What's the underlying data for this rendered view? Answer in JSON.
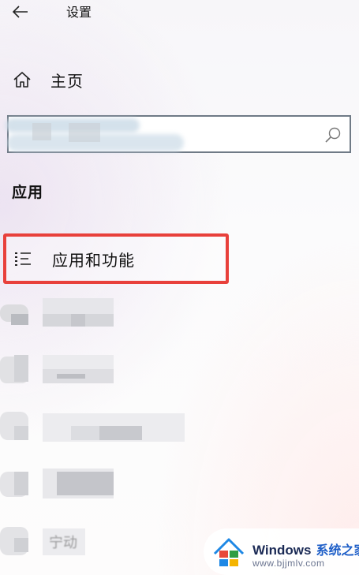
{
  "header": {
    "title": "设置",
    "back_icon": "back-arrow-icon"
  },
  "nav": {
    "home_label": "主页",
    "home_icon": "home-icon"
  },
  "search": {
    "value": "",
    "placeholder": "",
    "icon": "search-icon"
  },
  "section": {
    "title": "应用"
  },
  "menu": {
    "active_item": {
      "label": "应用和功能",
      "icon": "list-icon"
    },
    "obscured_partial_text": "宁动",
    "highlight_color": "#e8403b"
  },
  "watermark": {
    "brand": "Windows",
    "brand_cn": "系统之家",
    "url": "www.bjjmlv.com",
    "logo_colors": [
      "#e84a3a",
      "#2f9e44",
      "#1e88e5",
      "#f4b400"
    ]
  }
}
